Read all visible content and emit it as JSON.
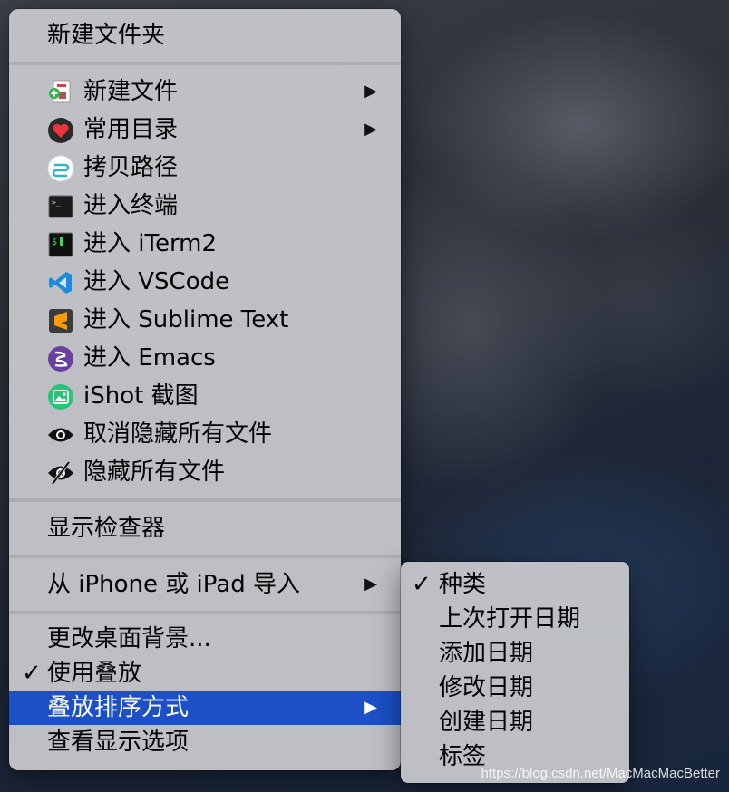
{
  "menu": {
    "new_folder": "新建文件夹",
    "group1": [
      {
        "label": "新建文件",
        "icon": "new-file-icon",
        "has_submenu": true
      },
      {
        "label": "常用目录",
        "icon": "heart-icon",
        "has_submenu": true
      },
      {
        "label": "拷贝路径",
        "icon": "copy-path-icon",
        "has_submenu": false
      },
      {
        "label": "进入终端",
        "icon": "terminal-icon",
        "has_submenu": false
      },
      {
        "label": "进入 iTerm2",
        "icon": "iterm2-icon",
        "has_submenu": false
      },
      {
        "label": "进入 VSCode",
        "icon": "vscode-icon",
        "has_submenu": false
      },
      {
        "label": "进入 Sublime Text",
        "icon": "sublime-icon",
        "has_submenu": false
      },
      {
        "label": "进入 Emacs",
        "icon": "emacs-icon",
        "has_submenu": false
      },
      {
        "label": "iShot 截图",
        "icon": "ishot-icon",
        "has_submenu": false
      },
      {
        "label": "取消隐藏所有文件",
        "icon": "eye-icon",
        "has_submenu": false
      },
      {
        "label": "隐藏所有文件",
        "icon": "eye-slash-icon",
        "has_submenu": false
      }
    ],
    "show_inspector": "显示检查器",
    "import_from_iphone": "从 iPhone 或 iPad 导入",
    "change_background": "更改桌面背景...",
    "use_stacks": "使用叠放",
    "stacks_sort": "叠放排序方式",
    "show_view_options": "查看显示选项"
  },
  "submenu": {
    "items": [
      {
        "label": "种类",
        "checked": true
      },
      {
        "label": "上次打开日期",
        "checked": false
      },
      {
        "label": "添加日期",
        "checked": false
      },
      {
        "label": "修改日期",
        "checked": false
      },
      {
        "label": "创建日期",
        "checked": false
      },
      {
        "label": "标签",
        "checked": false
      }
    ]
  },
  "watermark": "https://blog.csdn.net/MacMacMacBetter",
  "colors": {
    "selection": "#1d4fc7",
    "menu_bg": "#c8c9cd"
  }
}
